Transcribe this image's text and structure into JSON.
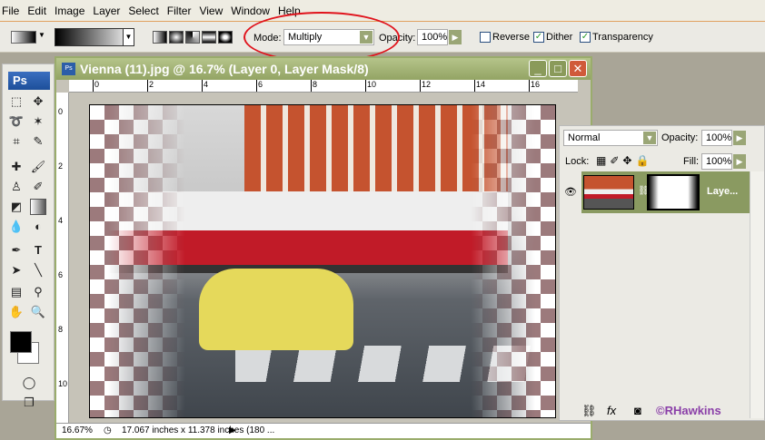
{
  "menu": [
    "File",
    "Edit",
    "Image",
    "Layer",
    "Select",
    "Filter",
    "View",
    "Window",
    "Help"
  ],
  "options": {
    "mode_label": "Mode:",
    "mode_value": "Multiply",
    "opacity_label": "Opacity:",
    "opacity_value": "100%",
    "reverse_label": "Reverse",
    "reverse_checked": false,
    "dither_label": "Dither",
    "dither_checked": true,
    "transparency_label": "Transparency",
    "transparency_checked": true
  },
  "toolbox": {
    "logo": "Ps"
  },
  "document": {
    "title": "Vienna (11).jpg @ 16.7% (Layer 0, Layer Mask/8)",
    "ruler_top": [
      "0",
      "2",
      "4",
      "6",
      "8",
      "10",
      "12",
      "14",
      "16"
    ],
    "ruler_left": [
      "0",
      "2",
      "4",
      "6",
      "8",
      "10"
    ],
    "zoom": "16.67%",
    "doc_info": "17.067 inches x 11.378 inches (180 ..."
  },
  "layers": {
    "blend_mode": "Normal",
    "opacity_label": "Opacity:",
    "opacity_value": "100%",
    "lock_label": "Lock:",
    "fill_label": "Fill:",
    "fill_value": "100%",
    "layer_name": "Laye...",
    "watermark": "©RHawkins"
  },
  "colors": {
    "annotation": "#e0131c",
    "accent": "#9aa676"
  }
}
